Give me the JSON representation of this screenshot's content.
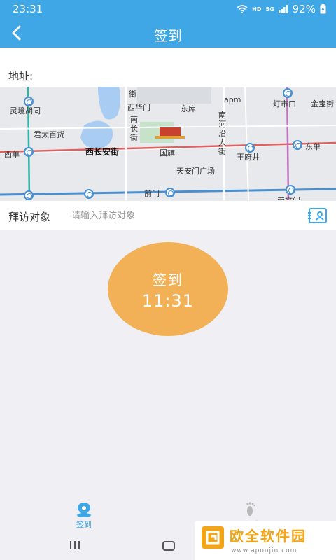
{
  "status_bar": {
    "time": "23:31",
    "network": "HD",
    "network_gen": "5G",
    "battery": "92%"
  },
  "header": {
    "title": "签到",
    "back_icon": "chevron-left-icon"
  },
  "address": {
    "label": "地址:"
  },
  "map": {
    "labels": {
      "linjing": "灵境胡同",
      "juntai": "君太百货",
      "xidan": "西单",
      "xichangan": "西长安街",
      "xihuamen": "西华门",
      "donghu": "东库",
      "nanchang_jie": "南\n长\n街",
      "jie_top": "街",
      "guoqi": "国旗",
      "tiananmen": "天安门广场",
      "qianmen": "前门",
      "apm": "apm",
      "nanheyan": "南\n河\n沿\n大\n街",
      "wangfujing": "王府井",
      "dengshikou": "灯市口",
      "jinbao": "金宝街",
      "dongdan": "东单",
      "chongwenmen": "崇文门"
    }
  },
  "visit": {
    "label": "拜访对象",
    "placeholder": "请输入拜访对象"
  },
  "checkin": {
    "label": "签到",
    "time": "11:31"
  },
  "tabs": [
    {
      "label": "签到",
      "icon": "location-pin-icon",
      "active": true
    },
    {
      "label": "足迹",
      "icon": "footprint-icon",
      "active": false
    }
  ],
  "watermark": {
    "text": "欧全软件园",
    "url": "www.apoujin.com"
  },
  "colors": {
    "primary": "#3fa7e6",
    "checkin": "#f3b157",
    "accent_orange": "#f2a516"
  }
}
